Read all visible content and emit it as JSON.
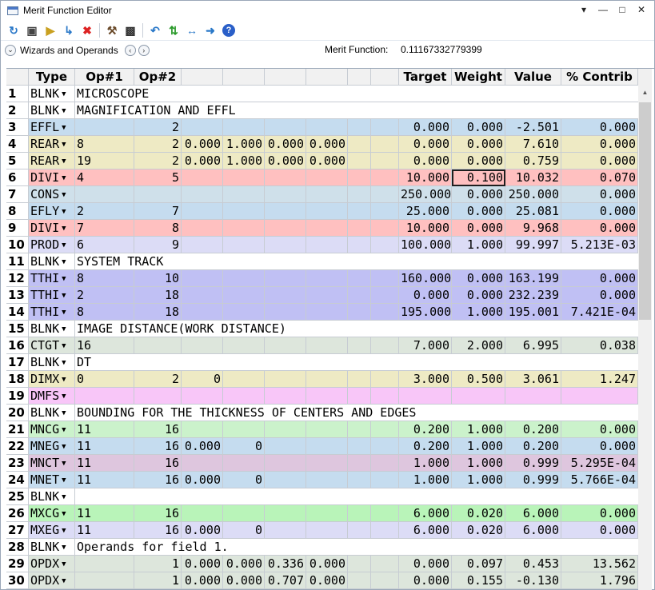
{
  "window": {
    "title": "Merit Function Editor"
  },
  "toolbar": {
    "icons": [
      "refresh-icon",
      "save-icon",
      "load-icon",
      "insert-icon",
      "delete-icon",
      "wizard-icon",
      "settings-icon",
      "undo-icon",
      "update-icon",
      "expand-icon",
      "arrow-right-icon",
      "help-icon"
    ]
  },
  "wizard": {
    "label": "Wizards and Operands",
    "merit_label": "Merit Function:",
    "merit_value": "0.11167332779399"
  },
  "columns": [
    "",
    "Type",
    "Op#1",
    "Op#2",
    "",
    "",
    "",
    "",
    "",
    "",
    "Target",
    "Weight",
    "Value",
    "% Contrib"
  ],
  "rows": [
    {
      "n": "1",
      "type": "BLNK",
      "comment": "MICROSCOPE",
      "bg": "#ffffff"
    },
    {
      "n": "2",
      "type": "BLNK",
      "comment": "MAGNIFICATION AND EFFL",
      "bg": "#ffffff"
    },
    {
      "n": "3",
      "type": "EFFL",
      "op1": "",
      "op2": "2",
      "target": "0.000",
      "weight": "0.000",
      "value": "-2.501",
      "contrib": "0.000",
      "bg": "#c5dcef"
    },
    {
      "n": "4",
      "type": "REAR",
      "op1": "8",
      "op2": "2",
      "h1": "0.000",
      "h2": "1.000",
      "h3": "0.000",
      "h4": "0.000",
      "target": "0.000",
      "weight": "0.000",
      "value": "7.610",
      "contrib": "0.000",
      "bg": "#eeeac4"
    },
    {
      "n": "5",
      "type": "REAR",
      "op1": "19",
      "op2": "2",
      "h1": "0.000",
      "h2": "1.000",
      "h3": "0.000",
      "h4": "0.000",
      "target": "0.000",
      "weight": "0.000",
      "value": "0.759",
      "contrib": "0.000",
      "bg": "#eeeac4"
    },
    {
      "n": "6",
      "type": "DIVI",
      "op1": "4",
      "op2": "5",
      "target": "10.000",
      "weight": "0.100",
      "value": "10.032",
      "contrib": "0.070",
      "bg": "#ffc0c0",
      "selected": "weight"
    },
    {
      "n": "7",
      "type": "CONS",
      "op1": "",
      "op2": "",
      "target": "250.000",
      "weight": "0.000",
      "value": "250.000",
      "contrib": "0.000",
      "bg": "#cfe0ea"
    },
    {
      "n": "8",
      "type": "EFLY",
      "op1": "2",
      "op2": "7",
      "target": "25.000",
      "weight": "0.000",
      "value": "25.081",
      "contrib": "0.000",
      "bg": "#c5dcef"
    },
    {
      "n": "9",
      "type": "DIVI",
      "op1": "7",
      "op2": "8",
      "target": "10.000",
      "weight": "0.000",
      "value": "9.968",
      "contrib": "0.000",
      "bg": "#ffc0c0"
    },
    {
      "n": "10",
      "type": "PROD",
      "op1": "6",
      "op2": "9",
      "target": "100.000",
      "weight": "1.000",
      "value": "99.997",
      "contrib": "5.213E-03",
      "bg": "#dcdcf6"
    },
    {
      "n": "11",
      "type": "BLNK",
      "comment": "SYSTEM TRACK",
      "bg": "#ffffff"
    },
    {
      "n": "12",
      "type": "TTHI",
      "op1": "8",
      "op2": "10",
      "target": "160.000",
      "weight": "0.000",
      "value": "163.199",
      "contrib": "0.000",
      "bg": "#c0c0f4"
    },
    {
      "n": "13",
      "type": "TTHI",
      "op1": "2",
      "op2": "18",
      "target": "0.000",
      "weight": "0.000",
      "value": "232.239",
      "contrib": "0.000",
      "bg": "#c0c0f4"
    },
    {
      "n": "14",
      "type": "TTHI",
      "op1": "8",
      "op2": "18",
      "target": "195.000",
      "weight": "1.000",
      "value": "195.001",
      "contrib": "7.421E-04",
      "bg": "#c0c0f4"
    },
    {
      "n": "15",
      "type": "BLNK",
      "comment": "IMAGE DISTANCE(WORK DISTANCE)",
      "bg": "#ffffff"
    },
    {
      "n": "16",
      "type": "CTGT",
      "op1": "16",
      "op2": "",
      "target": "7.000",
      "weight": "2.000",
      "value": "6.995",
      "contrib": "0.038",
      "bg": "#dde6dc"
    },
    {
      "n": "17",
      "type": "BLNK",
      "comment": "DT",
      "bg": "#ffffff"
    },
    {
      "n": "18",
      "type": "DIMX",
      "op1": "0",
      "op2": "2",
      "h1": "0",
      "target": "3.000",
      "weight": "0.500",
      "value": "3.061",
      "contrib": "1.247",
      "bg": "#eeeac4"
    },
    {
      "n": "19",
      "type": "DMFS",
      "op1": "",
      "op2": "",
      "target": "",
      "weight": "",
      "value": "",
      "contrib": "",
      "bg": "#f8c6f8"
    },
    {
      "n": "20",
      "type": "BLNK",
      "comment": "BOUNDING FOR THE THICKNESS OF CENTERS AND EDGES",
      "bg": "#ffffff"
    },
    {
      "n": "21",
      "type": "MNCG",
      "op1": "11",
      "op2": "16",
      "target": "0.200",
      "weight": "1.000",
      "value": "0.200",
      "contrib": "0.000",
      "bg": "#cbf2cb"
    },
    {
      "n": "22",
      "type": "MNEG",
      "op1": "11",
      "op2": "16",
      "h1": "0.000",
      "h2": "0",
      "target": "0.200",
      "weight": "1.000",
      "value": "0.200",
      "contrib": "0.000",
      "bg": "#c5dcef"
    },
    {
      "n": "23",
      "type": "MNCT",
      "op1": "11",
      "op2": "16",
      "target": "1.000",
      "weight": "1.000",
      "value": "0.999",
      "contrib": "5.295E-04",
      "bg": "#dec6de"
    },
    {
      "n": "24",
      "type": "MNET",
      "op1": "11",
      "op2": "16",
      "h1": "0.000",
      "h2": "0",
      "target": "1.000",
      "weight": "1.000",
      "value": "0.999",
      "contrib": "5.766E-04",
      "bg": "#c5dcef"
    },
    {
      "n": "25",
      "type": "BLNK",
      "comment": "",
      "bg": "#ffffff"
    },
    {
      "n": "26",
      "type": "MXCG",
      "op1": "11",
      "op2": "16",
      "target": "6.000",
      "weight": "0.020",
      "value": "6.000",
      "contrib": "0.000",
      "bg": "#b9f4b9"
    },
    {
      "n": "27",
      "type": "MXEG",
      "op1": "11",
      "op2": "16",
      "h1": "0.000",
      "h2": "0",
      "target": "6.000",
      "weight": "0.020",
      "value": "6.000",
      "contrib": "0.000",
      "bg": "#dcdcf6"
    },
    {
      "n": "28",
      "type": "BLNK",
      "comment": "Operands for field 1.",
      "bg": "#ffffff"
    },
    {
      "n": "29",
      "type": "OPDX",
      "op1": "",
      "op2": "1",
      "h1": "0.000",
      "h2": "0.000",
      "h3": "0.336",
      "h4": "0.000",
      "target": "0.000",
      "weight": "0.097",
      "value": "0.453",
      "contrib": "13.562",
      "bg": "#dde6dc"
    },
    {
      "n": "30",
      "type": "OPDX",
      "op1": "",
      "op2": "1",
      "h1": "0.000",
      "h2": "0.000",
      "h3": "0.707",
      "h4": "0.000",
      "target": "0.000",
      "weight": "0.155",
      "value": "-0.130",
      "contrib": "1.796",
      "bg": "#dde6dc"
    }
  ]
}
